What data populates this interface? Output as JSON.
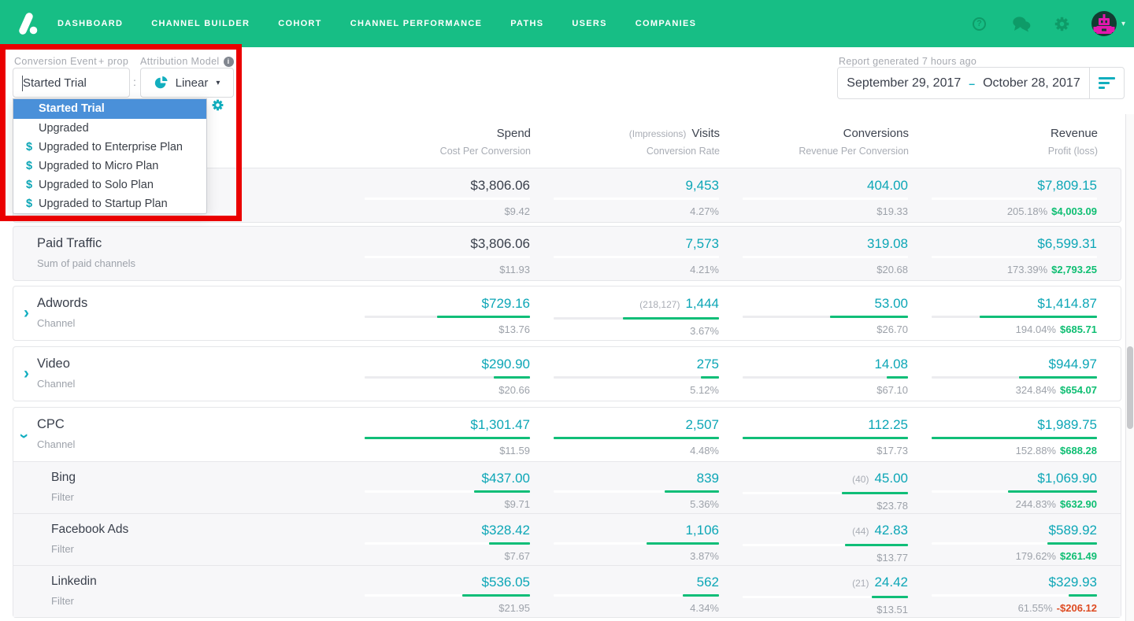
{
  "nav": {
    "items": [
      "DASHBOARD",
      "CHANNEL BUILDER",
      "COHORT",
      "CHANNEL PERFORMANCE",
      "PATHS",
      "USERS",
      "COMPANIES"
    ]
  },
  "icons": {
    "question": "?",
    "info": "i",
    "caret_down": "▾",
    "chevron": "›",
    "dollar": "$"
  },
  "colors": {
    "nav_green": "#17BE85",
    "value_teal": "#0CA6B6",
    "bar_green": "#10BE78",
    "profit_green": "#0EBE72",
    "loss_red": "#DE4B22",
    "highlight_blue": "#4A90D9",
    "annotation_red": "#EA0000"
  },
  "toolbar": {
    "conversion_event_label": "Conversion Event",
    "add_prop_label": "+ prop",
    "conversion_event_value": "Started Trial",
    "separator": ":",
    "attribution_model_label": "Attribution Model",
    "attribution_model_value": "Linear",
    "dropdown_options": [
      {
        "label": "Started Trial",
        "selected": true
      },
      {
        "label": "Upgraded"
      },
      {
        "label": "Upgraded to Enterprise Plan",
        "has_dollar": true
      },
      {
        "label": "Upgraded to Micro Plan",
        "has_dollar": true
      },
      {
        "label": "Upgraded to Solo Plan",
        "has_dollar": true
      },
      {
        "label": "Upgraded to Startup Plan",
        "has_dollar": true
      }
    ]
  },
  "report": {
    "generated_label": "Report generated 7 hours ago",
    "date_start": "September 29, 2017",
    "date_separator": "–",
    "date_end": "October 28, 2017"
  },
  "table": {
    "columns": [
      {
        "main": "Spend",
        "sub": "Cost Per Conversion"
      },
      {
        "pre": "(Impressions)",
        "main": "Visits",
        "sub": "Conversion Rate"
      },
      {
        "main": "Conversions",
        "sub": "Revenue Per Conversion"
      },
      {
        "main": "Revenue",
        "sub": "Profit (loss)"
      }
    ],
    "rows": [
      {
        "title": "",
        "subtitle": "",
        "type": "summary",
        "cells": [
          {
            "main": "$3,806.06",
            "sub": "$9.42"
          },
          {
            "main": "9,453",
            "sub": "4.27%"
          },
          {
            "main": "404.00",
            "sub": "$19.33"
          },
          {
            "main": "$7,809.15",
            "sub_pct": "205.18%",
            "sub_amt": "$4,003.09"
          }
        ]
      },
      {
        "title": "Paid Traffic",
        "subtitle": "Sum of paid channels",
        "type": "summary",
        "cells": [
          {
            "main": "$3,806.06",
            "sub": "$11.93"
          },
          {
            "main": "7,573",
            "sub": "4.21%"
          },
          {
            "main": "319.08",
            "sub": "$20.68"
          },
          {
            "main": "$6,599.31",
            "sub_pct": "173.39%",
            "sub_amt": "$2,793.25"
          }
        ]
      },
      {
        "title": "Adwords",
        "subtitle": "Channel",
        "type": "channel",
        "expanded": false,
        "cells": [
          {
            "main": "$729.16",
            "sub": "$13.76",
            "bar": 0.56
          },
          {
            "pre": "(218,127)",
            "main": "1,444",
            "sub": "3.67%",
            "bar": 0.58
          },
          {
            "main": "53.00",
            "sub": "$26.70",
            "bar": 0.47
          },
          {
            "main": "$1,414.87",
            "sub_pct": "194.04%",
            "sub_amt": "$685.71",
            "bar": 0.71
          }
        ]
      },
      {
        "title": "Video",
        "subtitle": "Channel",
        "type": "channel",
        "expanded": false,
        "cells": [
          {
            "main": "$290.90",
            "sub": "$20.66",
            "bar": 0.22
          },
          {
            "main": "275",
            "sub": "5.12%",
            "bar": 0.11
          },
          {
            "main": "14.08",
            "sub": "$67.10",
            "bar": 0.13
          },
          {
            "main": "$944.97",
            "sub_pct": "324.84%",
            "sub_amt": "$654.07",
            "bar": 0.47
          }
        ]
      },
      {
        "title": "CPC",
        "subtitle": "Channel",
        "type": "channel",
        "expanded": true,
        "cells": [
          {
            "main": "$1,301.47",
            "sub": "$11.59",
            "bar": 1
          },
          {
            "main": "2,507",
            "sub": "4.48%",
            "bar": 1
          },
          {
            "main": "112.25",
            "sub": "$17.73",
            "bar": 1
          },
          {
            "main": "$1,989.75",
            "sub_pct": "152.88%",
            "sub_amt": "$688.28",
            "bar": 1
          }
        ]
      },
      {
        "title": "Bing",
        "subtitle": "Filter",
        "type": "filter",
        "cells": [
          {
            "main": "$437.00",
            "sub": "$9.71",
            "bar": 0.34
          },
          {
            "main": "839",
            "sub": "5.36%",
            "bar": 0.33
          },
          {
            "pre": "(40)",
            "main": "45.00",
            "sub": "$23.78",
            "bar": 0.4
          },
          {
            "main": "$1,069.90",
            "sub_pct": "244.83%",
            "sub_amt": "$632.90",
            "bar": 0.54
          }
        ]
      },
      {
        "title": "Facebook Ads",
        "subtitle": "Filter",
        "type": "filter",
        "cells": [
          {
            "main": "$328.42",
            "sub": "$7.67",
            "bar": 0.25
          },
          {
            "main": "1,106",
            "sub": "3.87%",
            "bar": 0.44
          },
          {
            "pre": "(44)",
            "main": "42.83",
            "sub": "$13.77",
            "bar": 0.38
          },
          {
            "main": "$589.92",
            "sub_pct": "179.62%",
            "sub_amt": "$261.49",
            "bar": 0.3
          }
        ]
      },
      {
        "title": "Linkedin",
        "subtitle": "Filter",
        "type": "filter",
        "cells": [
          {
            "main": "$536.05",
            "sub": "$21.95",
            "bar": 0.41
          },
          {
            "main": "562",
            "sub": "4.34%",
            "bar": 0.22
          },
          {
            "pre": "(21)",
            "main": "24.42",
            "sub": "$13.51",
            "bar": 0.22
          },
          {
            "main": "$329.93",
            "sub_pct": "61.55%",
            "sub_amt": "-$206.12",
            "sub_negative": true,
            "bar": 0.17
          }
        ]
      }
    ]
  }
}
